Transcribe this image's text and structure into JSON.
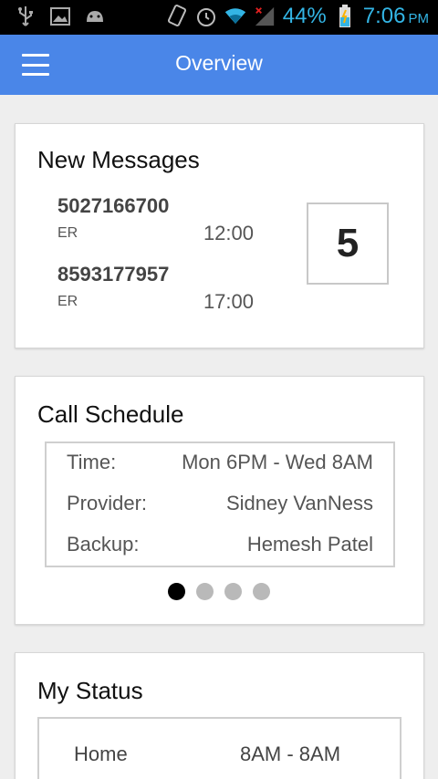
{
  "status_bar": {
    "battery_percent": "44%",
    "time": "7:06",
    "ampm": "PM",
    "icons": [
      "usb-icon",
      "image-icon",
      "android-icon",
      "vibrate-icon",
      "alarm-icon",
      "wifi-icon",
      "signal-icon",
      "battery-icon"
    ]
  },
  "app_bar": {
    "title": "Overview"
  },
  "messages": {
    "title": "New Messages",
    "count": "5",
    "items": [
      {
        "number": "5027166700",
        "dept": "ER",
        "time": "12:00"
      },
      {
        "number": "8593177957",
        "dept": "ER",
        "time": "17:00"
      }
    ]
  },
  "schedule": {
    "title": "Call Schedule",
    "rows": [
      {
        "label": "Time:",
        "value": "Mon 6PM - Wed 8AM"
      },
      {
        "label": "Provider:",
        "value": "Sidney VanNess"
      },
      {
        "label": "Backup:",
        "value": "Hemesh Patel"
      }
    ],
    "pager": {
      "pages": 4,
      "active": 1
    }
  },
  "status": {
    "title": "My Status",
    "rows": [
      {
        "label": "Home",
        "value": "8AM - 8AM"
      }
    ]
  },
  "colors": {
    "app_bar": "#4a86e8",
    "status_bar_accent": "#33b5e5"
  }
}
